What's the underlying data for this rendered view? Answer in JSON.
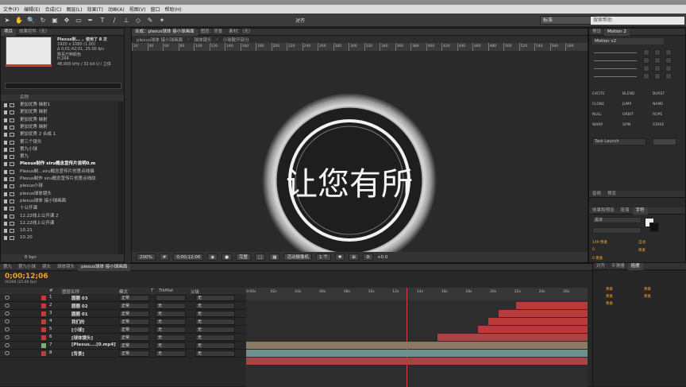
{
  "menu": [
    "文件(F)",
    "编辑(E)",
    "合成(C)",
    "图层(L)",
    "效果(T)",
    "动画(A)",
    "视图(V)",
    "窗口",
    "帮助(H)"
  ],
  "toolbar": {
    "workspace_label": "对齐",
    "workspace_value": "标准",
    "search_placeholder": "搜索帮助"
  },
  "project": {
    "tabs": [
      "项目",
      "效果控件（无）"
    ],
    "item_name": "Plexus制... ，使用了 8 次",
    "info": [
      "1920 x 1080 (1.00)",
      "Δ 0;01;42;01, 25.00 fps",
      "数百万种颜色",
      "H.264",
      "48.000 kHz / 32 bit U / 立体"
    ],
    "col_name": "名称",
    "items": [
      "更加优秀 映射1",
      "更加优秀 映射",
      "更加优秀 映射",
      "更加优秀 映射",
      "更加优秀 2 合成 1",
      "第三个镜头",
      "第九小球",
      "第九",
      "Plexus制作 siru概念宣传片说明0.m",
      "Plexus制...siru概念宣传片创意点线描",
      "Plexus制作 siru概念宣传片创意点线纹",
      "plexus小球",
      "plexus球体镜头",
      "plexus球体 接小球画面",
      "十公开课",
      "12.22线上公开课 2",
      "12.22线上公开课",
      "10.21",
      "10.20"
    ],
    "selected_index": 8,
    "footer": "8 bpc"
  },
  "comp": {
    "tabs": [
      "合成：plexus球体 接小球画面",
      "图层：背景",
      "素材：（无）"
    ],
    "subtabs": [
      "plexus球体 接小球画面",
      "球体镜头",
      "小球散开部分"
    ],
    "ruler": [
      "20",
      "40",
      "60",
      "80",
      "100",
      "120",
      "140",
      "160",
      "180",
      "200",
      "220",
      "240",
      "260",
      "280",
      "300",
      "320",
      "340",
      "360",
      "380",
      "400",
      "420",
      "440",
      "460",
      "480",
      "500",
      "520",
      "540",
      "560",
      "580"
    ],
    "viewer_text": "让您有所",
    "footer": {
      "zoom": "200%",
      "timecode": "0;00;12;06",
      "quality": "完整",
      "camera": "活动摄像机",
      "views": "1 个",
      "offset": "+0.0"
    }
  },
  "right": {
    "tabs": [
      "预设",
      "Motion 2"
    ],
    "motion_label": "Motion v2",
    "fx": [
      "EXCITE",
      "BLEND",
      "BURST",
      "CLONE",
      "JUMP",
      "NAME",
      "NULL",
      "ORBIT",
      "ROPE",
      "WARP",
      "SPIN",
      "STARE"
    ],
    "task": "Task Launch",
    "tabs2": [
      "音频",
      "预览"
    ],
    "tabs3": [
      "效果和预设",
      "段落",
      "字符"
    ],
    "font": "黑体",
    "style": "",
    "size_label": "149 像素",
    "lead_label": "自动",
    "track_label": "0",
    "stroke_label": "像素",
    "stroke_label2": "0 像素",
    "tracking": "像素",
    "tabs4": [
      "对齐",
      "平滑器",
      "摇摆"
    ],
    "r_props": [
      "0 像素",
      "0 像素",
      "0 像素",
      "0 像素"
    ]
  },
  "timeline": {
    "tabs": [
      "第九",
      "第九小球",
      "镜头",
      "球体镜头",
      "plexus球体 接小球画面"
    ],
    "time": "0;00;12;06",
    "fps": "00306 (25.00 fps)",
    "col_labels": [
      "#",
      "图层名称",
      "模式",
      "T",
      "TrkMat",
      "父级"
    ],
    "layers": [
      {
        "num": "1",
        "name": "圆圈 03",
        "mode": "正常",
        "trk": "",
        "parent": "无",
        "color": "#c23a3a"
      },
      {
        "num": "2",
        "name": "圆圈 02",
        "mode": "正常",
        "trk": "无",
        "parent": "无",
        "color": "#c23a3a"
      },
      {
        "num": "3",
        "name": "圆圈 01",
        "mode": "正常",
        "trk": "无",
        "parent": "无",
        "color": "#c23a3a"
      },
      {
        "num": "4",
        "name": "我们的",
        "mode": "正常",
        "trk": "无",
        "parent": "无",
        "color": "#c23a3a"
      },
      {
        "num": "5",
        "name": "[小球]",
        "mode": "正常",
        "trk": "无",
        "parent": "无",
        "color": "#c23a3a"
      },
      {
        "num": "6",
        "name": "[球体镜头]",
        "mode": "正常",
        "trk": "无",
        "parent": "无",
        "color": "#c23a3a"
      },
      {
        "num": "7",
        "name": "[Plexus....[0.mp4]",
        "mode": "正常",
        "trk": "无",
        "parent": "无",
        "color": "#7bb07b"
      },
      {
        "num": "8",
        "name": "[背景]",
        "mode": "正常",
        "trk": "无",
        "parent": "无",
        "color": "#c23a3a"
      }
    ],
    "ruler": [
      "0:00s",
      "02s",
      "04s",
      "06s",
      "08s",
      "10s",
      "12s",
      "14s",
      "16s",
      "18s",
      "20s",
      "22s",
      "24s",
      "26s"
    ],
    "playhead_sec": 12.2
  },
  "right_bottom": {
    "tabs": [
      "对齐",
      "平滑器",
      "摇摆"
    ],
    "items": [
      "像素",
      "像素",
      "像素",
      "像素",
      "像素"
    ]
  }
}
